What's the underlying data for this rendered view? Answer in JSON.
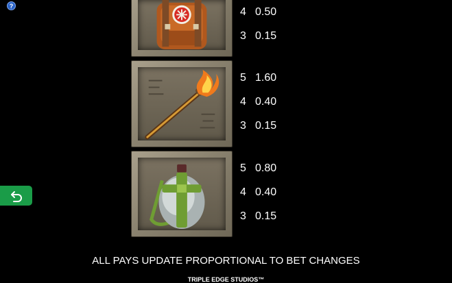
{
  "help_icon": {
    "glyph": "?"
  },
  "back_button": {
    "icon": "return-arrow-icon",
    "color": "#1a9c48"
  },
  "symbols": [
    {
      "name": "backpack",
      "pays": [
        {
          "count": "4",
          "value": "0.50"
        },
        {
          "count": "3",
          "value": "0.15"
        }
      ]
    },
    {
      "name": "torch",
      "pays": [
        {
          "count": "5",
          "value": "1.60"
        },
        {
          "count": "4",
          "value": "0.40"
        },
        {
          "count": "3",
          "value": "0.15"
        }
      ]
    },
    {
      "name": "canteen",
      "pays": [
        {
          "count": "5",
          "value": "0.80"
        },
        {
          "count": "4",
          "value": "0.40"
        },
        {
          "count": "3",
          "value": "0.15"
        }
      ]
    }
  ],
  "footer": {
    "note": "ALL PAYS UPDATE PROPORTIONAL TO BET CHANGES",
    "studio": "TRIPLE EDGE STUDIOS™"
  }
}
